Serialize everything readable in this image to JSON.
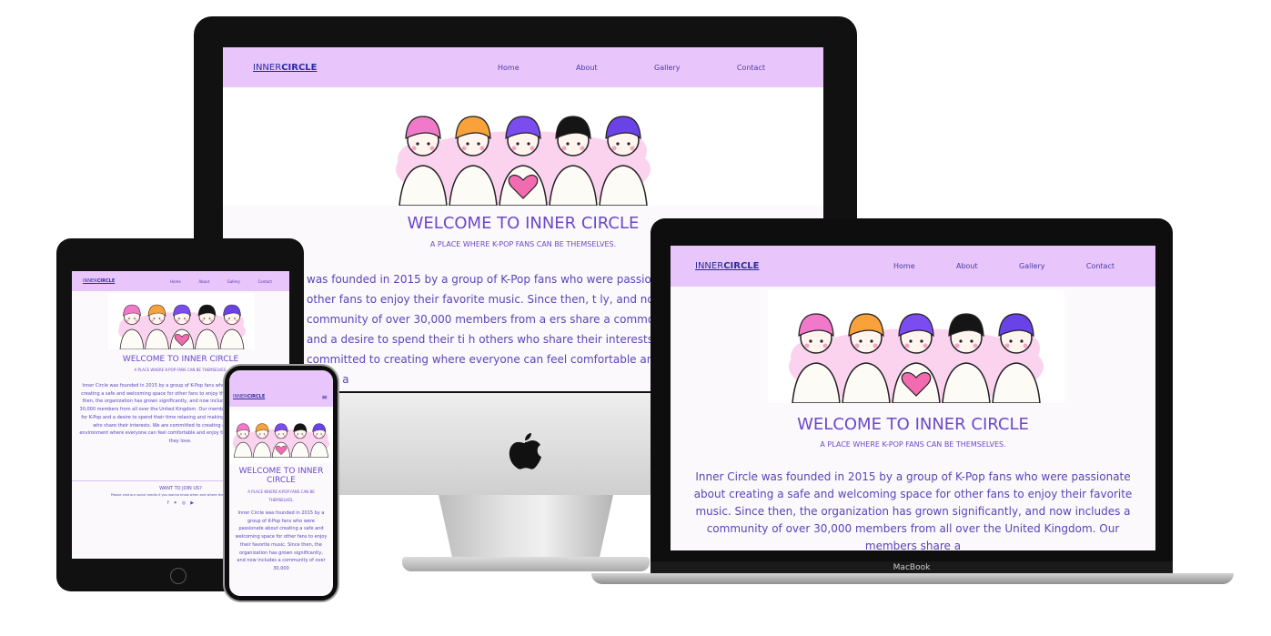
{
  "site": {
    "logo_part1": "INNER",
    "logo_part2": "CIRCLE",
    "nav": [
      "Home",
      "About",
      "Gallery",
      "Contact"
    ],
    "title": "WELCOME TO INNER CIRCLE",
    "subtitle": "A PLACE WHERE K-POP FANS CAN BE THEMSELVES.",
    "imac_body": "was founded in 2015 by a group of K-Pop fans who were passiona g space for other fans to enjoy their favorite music. Since then, t ly, and now includes a community of over 30,000 members from a ers share a common love for K-Pop and a desire to spend their ti h others who share their interests. We are committed to creating where everyone can feel comfortable and enjoy the music a",
    "laptop_body": "Inner Circle was founded in 2015 by a group of K-Pop fans who were passionate about creating a safe and welcoming space for other fans to enjoy their favorite music. Since then, the organization has grown significantly, and now includes a community of over 30,000 members from all over the United Kingdom. Our members share a",
    "tablet_body": "Inner Circle was founded in 2015 by a group of K-Pop fans who were passionate about creating a safe and welcoming space for other fans to enjoy their favorite music. Since then, the organization has grown significantly, and now includes a community of over 30,000 members from all over the United Kingdom. Our members share a common love for K-Pop and a desire to spend their time relaxing and making new friends with others who share their interests. We are committed to creating a safe and inclusive environment where everyone can feel comfortable and enjoy the music and culture that they love.",
    "phone_body": "Inner Circle was founded in 2015 by a group of K-Pop fans who were passionate about creating a safe and welcoming space for other fans to enjoy their favorite music. Since then, the organization has grown significantly, and now includes a community of over 30,000",
    "footer_heading": "WANT TO JOIN US?",
    "footer_text": "Please visit our social media if you wanna know when and where the next meetup is!",
    "social_icons": [
      "facebook-icon",
      "twitter-icon",
      "instagram-icon",
      "youtube-icon"
    ]
  },
  "devices": {
    "laptop_label": "MacBook"
  },
  "colors": {
    "nav_bg": "#e8c6fb",
    "accent": "#6b48c9",
    "logo": "#2d2a9e"
  }
}
